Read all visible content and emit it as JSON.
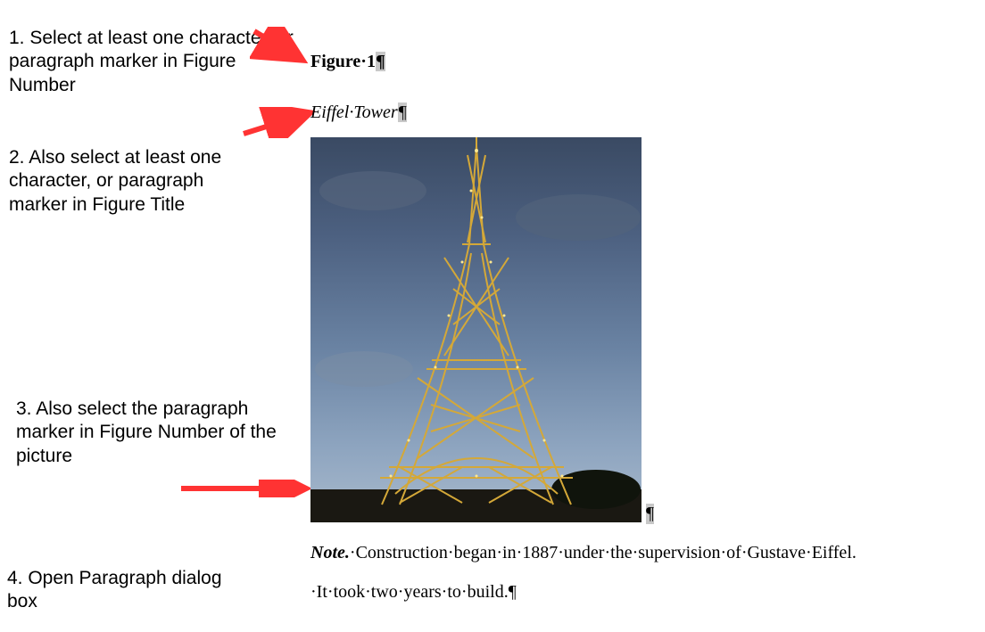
{
  "instructions": {
    "step1": "1. Select at least one character, or paragraph marker in Figure Number",
    "step2": "2. Also select at least one character, or paragraph marker in Figure Title",
    "step3": "3. Also select the paragraph marker in Figure Number of the picture",
    "step4": "4. Open Paragraph dialog box"
  },
  "document": {
    "figure_label": "Figure",
    "figure_number": "1",
    "figure_title": "Eiffel",
    "figure_title2": "Tower",
    "note_prefix": "Note.",
    "note_words": [
      "Construction",
      "began",
      "in",
      "1887",
      "under",
      "the",
      "supervision",
      "of",
      "Gustave",
      "Eiffel."
    ],
    "note_line2_words": [
      "It",
      "took",
      "two",
      "years",
      "to",
      "build."
    ]
  },
  "glyphs": {
    "pilcrow": "¶",
    "middot": "·",
    "nbsp": " "
  }
}
